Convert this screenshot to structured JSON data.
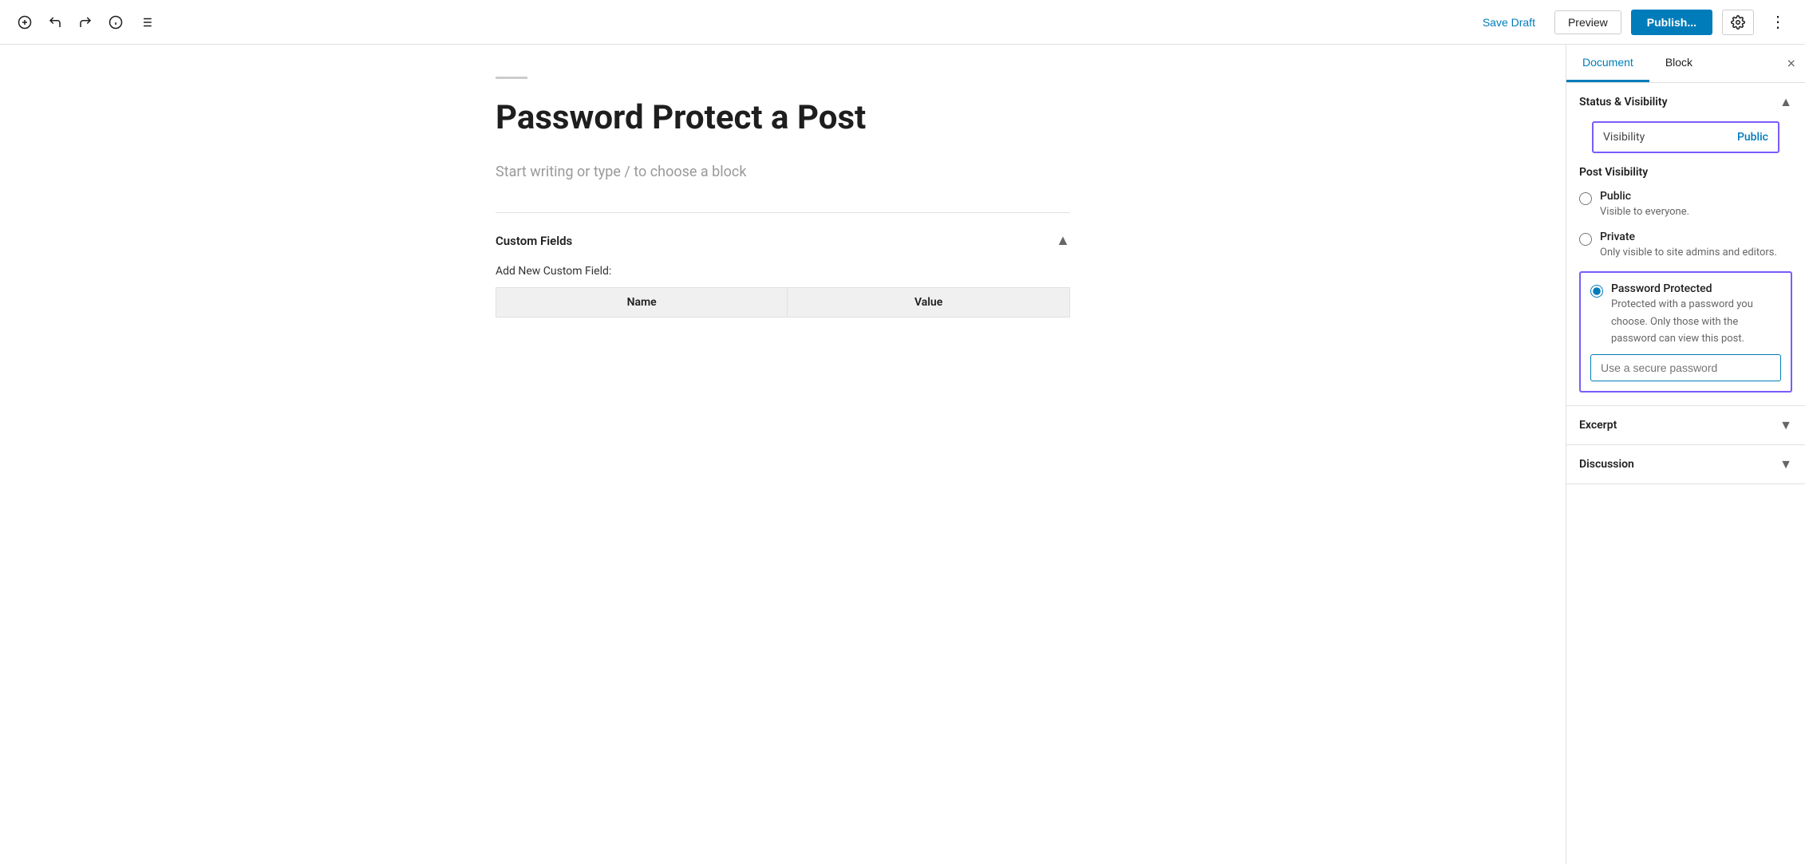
{
  "toolbar": {
    "add_label": "+",
    "undo_label": "↩",
    "redo_label": "↪",
    "info_label": "ℹ",
    "list_label": "≡",
    "save_draft_label": "Save Draft",
    "preview_label": "Preview",
    "publish_label": "Publish...",
    "settings_label": "⚙",
    "more_label": "⋮"
  },
  "editor": {
    "post_title": "Password Protect a Post",
    "post_placeholder": "Start writing or type / to choose a block"
  },
  "custom_fields": {
    "title": "Custom Fields",
    "add_label": "Add New Custom Field:",
    "col_name": "Name",
    "col_value": "Value"
  },
  "sidebar": {
    "tab_document": "Document",
    "tab_block": "Block",
    "close_label": "×",
    "status_visibility": {
      "title": "Status & Visibility",
      "toggle": "▲",
      "visibility_label": "Visibility",
      "visibility_value": "Public",
      "post_visibility_title": "Post Visibility",
      "options": [
        {
          "id": "public",
          "label": "Public",
          "desc": "Visible to everyone.",
          "checked": false
        },
        {
          "id": "private",
          "label": "Private",
          "desc": "Only visible to site admins and editors.",
          "checked": false
        },
        {
          "id": "password",
          "label": "Password Protected",
          "desc": "Protected with a password you choose. Only those with the password can view this post.",
          "checked": true
        }
      ],
      "password_placeholder": "Use a secure password"
    },
    "excerpt": {
      "title": "Excerpt",
      "toggle": "▼"
    },
    "discussion": {
      "title": "Discussion",
      "toggle": "▼"
    }
  },
  "colors": {
    "accent": "#007cba",
    "purple_border": "#7b5cfa",
    "publish_bg": "#007cba"
  }
}
